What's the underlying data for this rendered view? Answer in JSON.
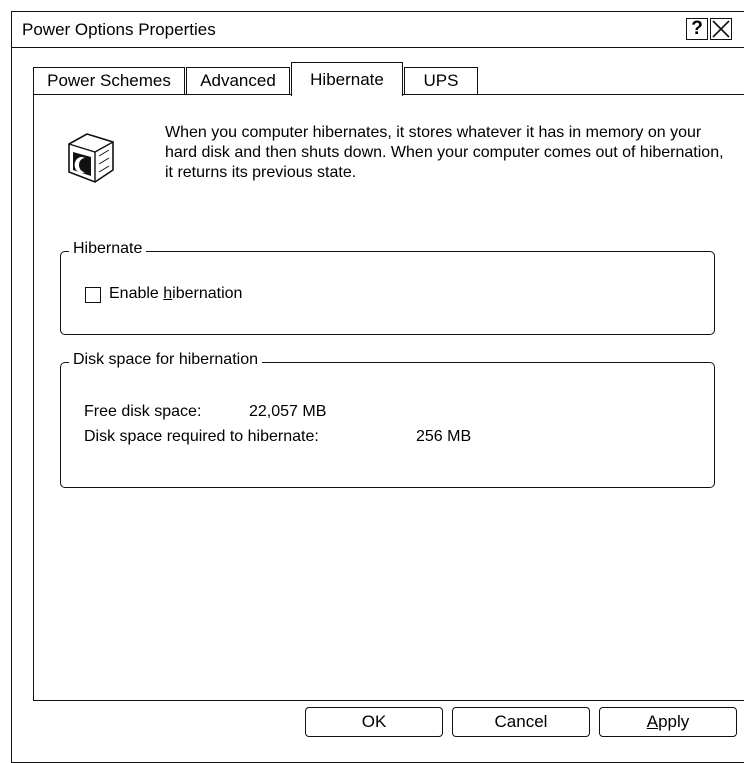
{
  "window": {
    "title": "Power Options Properties",
    "help_label": "?"
  },
  "tabs": [
    {
      "label": "Power Schemes"
    },
    {
      "label": "Advanced"
    },
    {
      "label": "Hibernate",
      "selected": true
    },
    {
      "label": "UPS"
    }
  ],
  "intro": {
    "icon": "hibernate-moon-icon",
    "text": "When you computer hibernates, it stores whatever it has in memory on your hard disk and then shuts down. When your computer comes out of hibernation, it returns its previous state."
  },
  "hibernate_group": {
    "legend": "Hibernate",
    "checkbox_label_pre": "Enable ",
    "checkbox_label_accel": "h",
    "checkbox_label_post": "ibernation",
    "checked": false
  },
  "disk_group": {
    "legend": "Disk space for hibernation",
    "free_label": "Free disk space:",
    "free_value": "22,057 MB",
    "required_label": "Disk space required to hibernate:",
    "required_value": "256 MB"
  },
  "buttons": {
    "ok": "OK",
    "cancel": "Cancel",
    "apply_accel": "A",
    "apply_rest": "pply"
  }
}
